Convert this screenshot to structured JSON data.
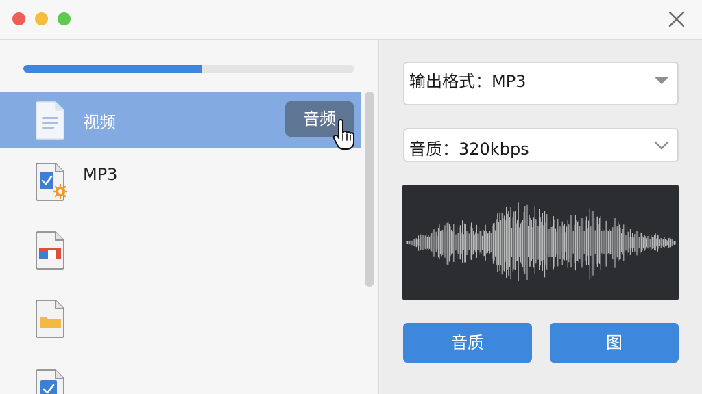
{
  "window": {
    "traffic_lights": [
      "close",
      "minimize",
      "zoom"
    ],
    "close_icon": "close-x-icon"
  },
  "progress": {
    "value_percent": 54,
    "color": "#3e86dc"
  },
  "file_list": {
    "items": [
      {
        "label": "视频",
        "icon": "document-icon",
        "selected": true
      },
      {
        "label": "MP3",
        "icon": "document-settings-icon",
        "selected": false
      },
      {
        "label": "",
        "icon": "presentation-file-icon",
        "selected": false
      },
      {
        "label": "",
        "icon": "folder-file-icon",
        "selected": false
      },
      {
        "label": "",
        "icon": "check-file-icon",
        "selected": false
      }
    ],
    "selected_action_label": "音频",
    "selection_color": "#83abe2"
  },
  "settings": {
    "format_select": "输出格式：MP3",
    "quality_select": "音质：320kbps"
  },
  "buttons": {
    "quality_label": "音质",
    "image_label": "图",
    "color": "#3d87dc"
  }
}
